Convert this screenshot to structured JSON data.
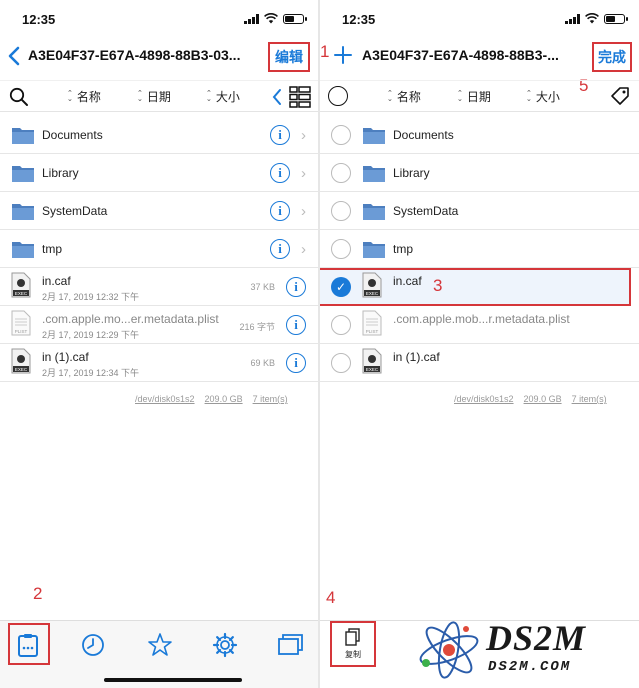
{
  "status": {
    "time": "12:35"
  },
  "nav": {
    "title_left": "A3E04F37-E67A-4898-88B3-03...",
    "title_right": "A3E04F37-E67A-4898-88B3-...",
    "edit": "编辑",
    "done": "完成"
  },
  "sort": {
    "name": "名称",
    "date": "日期",
    "size": "大小"
  },
  "files": [
    {
      "name": "Documents",
      "type": "folder"
    },
    {
      "name": "Library",
      "type": "folder"
    },
    {
      "name": "SystemData",
      "type": "folder"
    },
    {
      "name": "tmp",
      "type": "folder"
    },
    {
      "name": "in.caf",
      "type": "exec",
      "date": "2月 17, 2019 12:32 下午",
      "size": "37 KB"
    },
    {
      "name": ".com.apple.mo...er.metadata.plist",
      "name_right": ".com.apple.mob...r.metadata.plist",
      "type": "plist",
      "date": "2月 17, 2019 12:29 下午",
      "size": "216 字节"
    },
    {
      "name": "in (1).caf",
      "type": "exec",
      "date": "2月 17, 2019 12:34 下午",
      "size": "69 KB"
    }
  ],
  "footer": {
    "disk": "/dev/disk0s1s2",
    "free": "209.0 GB",
    "items": "7 item(s)"
  },
  "annotations": [
    "1",
    "2",
    "3",
    "4",
    "5"
  ],
  "toolbar": {
    "copy": "复制"
  },
  "logo": {
    "big": "DS2M",
    "small": "DS2M.COM"
  },
  "colors": {
    "accent": "#1a7ad8",
    "annotation": "#d5363a"
  }
}
